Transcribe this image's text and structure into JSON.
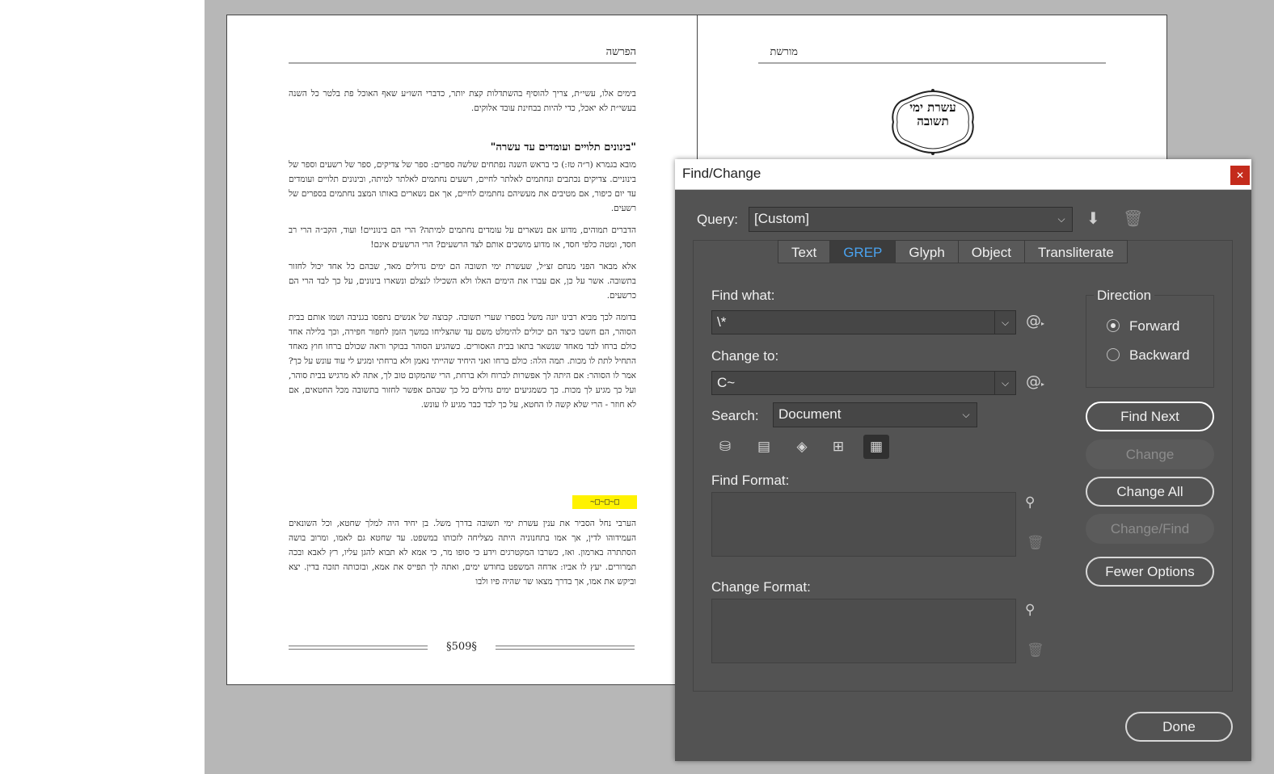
{
  "document": {
    "left_page": {
      "running_head": "הפרשה",
      "intro_paragraph": "בימים אלו, עשי״ת, צריך להוסיף בהשתדלות קצת יותר, כדברי השו״ע שאף האוכל פת בלטר כל השנה בעשי״ת לא יאכל, כדי להיות בבחינת עובד אלוקים.",
      "section_heading": "\"בינונים תלויים ועומדים עד עשרה\"",
      "paragraphs": [
        "מובא בגמרא (ר״ה טז:) כי בראש השנה נפתחים שלשה ספרים: ספר של צדיקים, ספר של רשעים וספר של בינוניים. צדיקים נכתבים ונחתמים לאלתר לחיים, רשעים נחתמים לאלתר למיתה, ובינונים תלויים ועומדים עד יום כיפור, אם מטיבים את מעשיהם נחתמים לחיים, אך אם נשארים באותו המצב נחתמים בספרים של רשעים.",
        "הדברים תמוהים, מדוע אם נשארים על עומדים נחתמים למיתה? הרי הם בינוניים! ועוד, הקב״ה הרי רב חסד, ומטה כלפי חסד, אז מדוע מושכים אותם לצד הרשעים? הרי הרשעים אינם!",
        "אלא מבאר הפני מנחם זצ״ל, שעשרת ימי תשובה הם ימים גדולים מאד, שבהם כל אחד יכול לחזור בתשובה. אשר על כן, אם עברו את הימים האלו ולא השכילו לנצלם ונשארו בינונים, על כך לבד הרי הם כרשעים.",
        "בדומה לכך מביא רבינו יונה משל בספרו שערי תשובה. קבוצה של אנשים נתפסו בגניבה ושמו אותם בבית הסוהר, הם חשבו כיצד הם יכולים להימלט משם עד שהצליחו במשך הזמן לחפור חפירה, וכך בלילה אחד כולם ברחו לבד מאחד שנשאר בתאו בבית האסורים. כשהגיע הסוהר בבוקר וראה שכולם ברחו חוץ מאחד התחיל לתת לו מכות. תמה הלה: כולם ברחו ואני היחיד שהייתי נאמן ולא ברחתי ומגיע לי עוד עונש על כך? אמר לו הסוהר: אם היתה לך אפשרות לברוח ולא ברחת, הרי שהמקום טוב לך, אתה לא מרגיש בבית סוהר, ועל כך מגיע לך מכות. כך כשמגיעים ימים גדולים כל כך שבהם אפשר לחזור בתשובה מכל החטאים, אם לא חוזר - הרי שלא קשה לו החטא, על כך לבד כבר מגיע לו עונש."
      ],
      "highlighted_marker": "~□~□~□",
      "closing_paragraph": "הערבי נחל הסביר את ענין עשרת ימי תשובה בדרך משל. בן יחיד היה למלך שחטא, וכל השונאים העמידוהו לדין, אך אמו בתחנוניה היתה מצליחה לזכותו במשפט. עד שחטא גם לאמו, ומרוב בושה הסתתרה בארמון. ואז, כשרבו המקטרגים וידע כי סופו מר, כי אמא לא תבוא להגן עליו, רץ לאבא ובכה תמרורים. יעץ לו אביו: אדחה המשפט בחודש ימים, ואתה לך תפייס את אמא, ובזכותה תזכה בדין. יצא וביקש את אמו, אך בדרך מצאו שר שהיה פיו ולבו",
      "folio": "509"
    },
    "right_page": {
      "running_head": "מורשת",
      "emblem_line1": "עשרת ימי",
      "emblem_line2": "תשובה"
    }
  },
  "dialog": {
    "title": "Find/Change",
    "close_icon": "close-icon",
    "query_label": "Query:",
    "query_value": "[Custom]",
    "tabs": [
      {
        "label": "Text",
        "active": false
      },
      {
        "label": "GREP",
        "active": true
      },
      {
        "label": "Glyph",
        "active": false
      },
      {
        "label": "Object",
        "active": false
      },
      {
        "label": "Transliterate",
        "active": false
      }
    ],
    "find_what_label": "Find what:",
    "find_what_value": "\\*",
    "change_to_label": "Change to:",
    "change_to_value": "C~",
    "search_label": "Search:",
    "search_value": "Document",
    "find_format_label": "Find Format:",
    "change_format_label": "Change Format:",
    "direction": {
      "label": "Direction",
      "forward": "Forward",
      "backward": "Backward",
      "selected": "Forward"
    },
    "buttons": {
      "find_next": "Find Next",
      "change": "Change",
      "change_all": "Change All",
      "change_find": "Change/Find",
      "fewer_options": "Fewer Options",
      "done": "Done"
    },
    "accent_color": "#4aa3f0"
  }
}
